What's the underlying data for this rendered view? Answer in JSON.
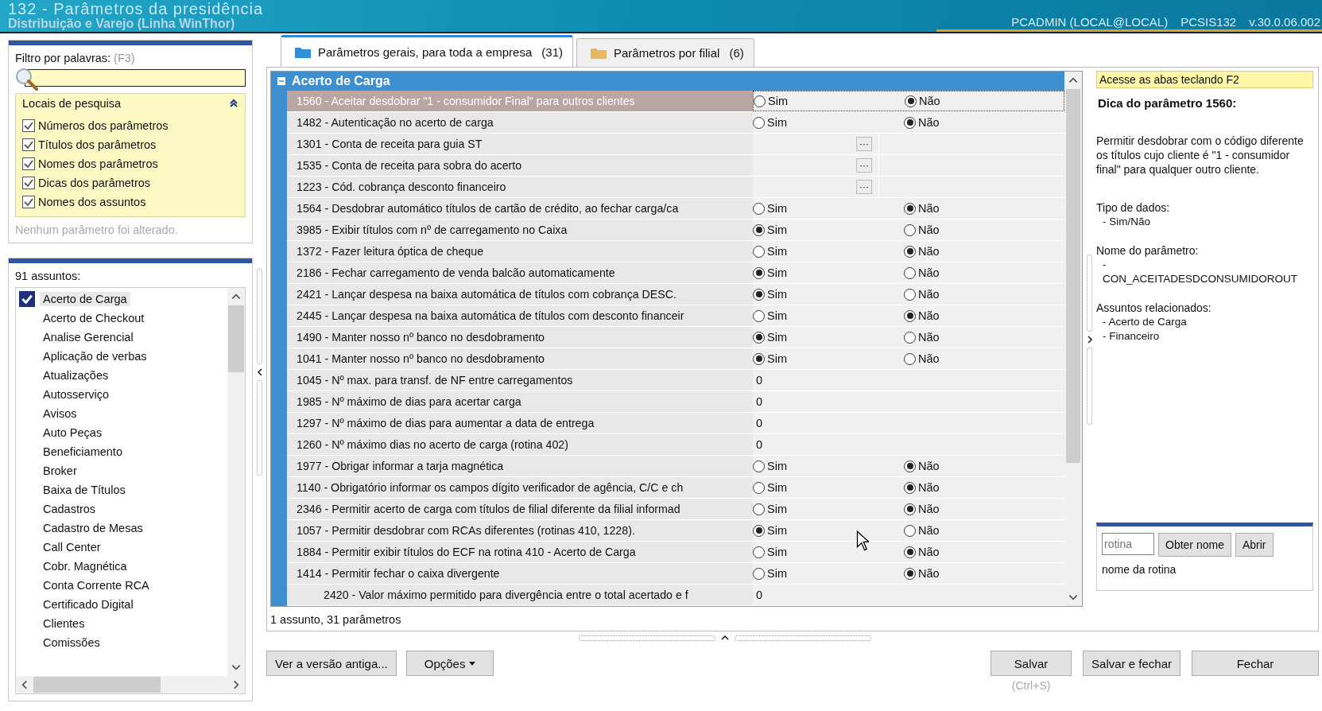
{
  "window": {
    "title": "132 - Parâmetros da presidência",
    "subtitle": "Distribuição e Varejo (Linha WinThor)",
    "user": "PCADMIN (LOCAL@LOCAL)",
    "program": "PCSIS132",
    "version": "v.30.0.06.002"
  },
  "filter": {
    "label": "Filtro por palavras:",
    "shortcut": "(F3)"
  },
  "search_locations": {
    "title": "Locais de pesquisa",
    "expanded": true,
    "options": [
      {
        "label": "Números dos parâmetros",
        "checked": true
      },
      {
        "label": "Títulos dos parâmetros",
        "checked": true
      },
      {
        "label": "Nomes dos parâmetros",
        "checked": true
      },
      {
        "label": "Dicas dos parâmetros",
        "checked": true
      },
      {
        "label": "Nomes dos assuntos",
        "checked": true
      }
    ]
  },
  "change_note": "Nenhum parâmetro foi alterado.",
  "subjects": {
    "count_label": "91 assuntos:",
    "items": [
      {
        "label": "Acerto de Carga",
        "checked": true,
        "selected": true
      },
      {
        "label": "Acerto de Checkout",
        "checked": false,
        "selected": false
      },
      {
        "label": "Analise Gerencial",
        "checked": false,
        "selected": false
      },
      {
        "label": "Aplicação de verbas",
        "checked": false,
        "selected": false
      },
      {
        "label": "Atualizações",
        "checked": false,
        "selected": false
      },
      {
        "label": "Autosserviço",
        "checked": false,
        "selected": false
      },
      {
        "label": "Avisos",
        "checked": false,
        "selected": false
      },
      {
        "label": "Auto Peças",
        "checked": false,
        "selected": false
      },
      {
        "label": "Beneficiamento",
        "checked": false,
        "selected": false
      },
      {
        "label": "Broker",
        "checked": false,
        "selected": false
      },
      {
        "label": "Baixa de Títulos",
        "checked": false,
        "selected": false
      },
      {
        "label": "Cadastros",
        "checked": false,
        "selected": false
      },
      {
        "label": "Cadastro de Mesas",
        "checked": false,
        "selected": false
      },
      {
        "label": "Call Center",
        "checked": false,
        "selected": false
      },
      {
        "label": "Cobr. Magnética",
        "checked": false,
        "selected": false
      },
      {
        "label": "Conta Corrente RCA",
        "checked": false,
        "selected": false
      },
      {
        "label": "Certificado Digital",
        "checked": false,
        "selected": false
      },
      {
        "label": "Clientes",
        "checked": false,
        "selected": false
      },
      {
        "label": "Comissões",
        "checked": false,
        "selected": false
      }
    ]
  },
  "tabs": [
    {
      "label": "Parâmetros gerais, para toda a empresa",
      "count": "(31)",
      "selected": true,
      "color": "#2f8fd8"
    },
    {
      "label": "Parâmetros por filial",
      "count": "(6)",
      "selected": false,
      "color": "#e8b860"
    }
  ],
  "group": {
    "title": "Acerto de Carga",
    "expanded": true
  },
  "parameters": [
    {
      "label": "1560 - Aceitar desdobrar \"1 - consumidor Final\" para outros clientes",
      "kind": "yesno",
      "selected": true,
      "options": [
        {
          "label": "Sim",
          "selected": false
        },
        {
          "label": "Não",
          "selected": true
        }
      ]
    },
    {
      "label": "1482 - Autenticação no acerto de carga",
      "kind": "yesno",
      "selected": false,
      "options": [
        {
          "label": "Sim",
          "selected": false
        },
        {
          "label": "Não",
          "selected": true
        }
      ]
    },
    {
      "label": "1301 - Conta de receita para guia ST",
      "kind": "lookup",
      "selected": false,
      "button": "···"
    },
    {
      "label": "1535 - Conta de receita para sobra do acerto",
      "kind": "lookup",
      "selected": false,
      "button": "···"
    },
    {
      "label": "1223 - Cód. cobrança desconto financeiro",
      "kind": "lookup",
      "selected": false,
      "button": "···"
    },
    {
      "label": "1564 - Desdobrar automático títulos de cartão de crédito, ao fechar carga/ca",
      "kind": "yesno",
      "selected": false,
      "options": [
        {
          "label": "Sim",
          "selected": false
        },
        {
          "label": "Não",
          "selected": true
        }
      ]
    },
    {
      "label": "3985 - Exibir títulos com nº de carregamento no Caixa",
      "kind": "yesno",
      "selected": false,
      "options": [
        {
          "label": "Sim",
          "selected": true
        },
        {
          "label": "Não",
          "selected": false
        }
      ]
    },
    {
      "label": "1372 - Fazer leitura óptica de cheque",
      "kind": "yesno",
      "selected": false,
      "options": [
        {
          "label": "Sim",
          "selected": false
        },
        {
          "label": "Não",
          "selected": true
        }
      ]
    },
    {
      "label": "2186 - Fechar carregamento de venda balcão automaticamente",
      "kind": "yesno",
      "selected": false,
      "options": [
        {
          "label": "Sim",
          "selected": true
        },
        {
          "label": "Não",
          "selected": false
        }
      ]
    },
    {
      "label": "2421 - Lançar despesa na baixa automática de títulos com cobrança DESC.",
      "kind": "yesno",
      "selected": false,
      "options": [
        {
          "label": "Sim",
          "selected": true
        },
        {
          "label": "Não",
          "selected": false
        }
      ]
    },
    {
      "label": "2445 - Lançar despesa na baixa automática de títulos com desconto financeir",
      "kind": "yesno",
      "selected": false,
      "options": [
        {
          "label": "Sim",
          "selected": false
        },
        {
          "label": "Não",
          "selected": true
        }
      ]
    },
    {
      "label": "1490 - Manter nosso nº banco no desdobramento",
      "kind": "yesno",
      "selected": false,
      "options": [
        {
          "label": "Sim",
          "selected": true
        },
        {
          "label": "Não",
          "selected": false
        }
      ]
    },
    {
      "label": "1041 - Manter nosso nº banco no desdobramento",
      "kind": "yesno",
      "selected": false,
      "options": [
        {
          "label": "Sim",
          "selected": true
        },
        {
          "label": "Não",
          "selected": false
        }
      ]
    },
    {
      "label": "1045 - Nº max. para transf. de NF entre carregamentos",
      "kind": "number",
      "selected": false,
      "value": "0"
    },
    {
      "label": "1985 - Nº máximo de dias para acertar carga",
      "kind": "number",
      "selected": false,
      "value": "0"
    },
    {
      "label": "1297 - Nº máximo de dias para aumentar a data de entrega",
      "kind": "number",
      "selected": false,
      "value": "0"
    },
    {
      "label": "1260 - Nº máximo dias no acerto de carga (rotina 402)",
      "kind": "number",
      "selected": false,
      "value": "0"
    },
    {
      "label": "1977 - Obrigar informar a tarja magnética",
      "kind": "yesno",
      "selected": false,
      "options": [
        {
          "label": "Sim",
          "selected": false
        },
        {
          "label": "Não",
          "selected": true
        }
      ]
    },
    {
      "label": "1140 - Obrigatório informar os campos dígito verificador de agência, C/C e ch",
      "kind": "yesno",
      "selected": false,
      "options": [
        {
          "label": "Sim",
          "selected": false
        },
        {
          "label": "Não",
          "selected": true
        }
      ]
    },
    {
      "label": "2346 - Permitir acerto de carga com títulos de filial diferente da filial informad",
      "kind": "yesno",
      "selected": false,
      "options": [
        {
          "label": "Sim",
          "selected": false
        },
        {
          "label": "Não",
          "selected": true
        }
      ]
    },
    {
      "label": "1057 - Permitir desdobrar com RCAs diferentes (rotinas 410, 1228).",
      "kind": "yesno",
      "selected": false,
      "options": [
        {
          "label": "Sim",
          "selected": true
        },
        {
          "label": "Não",
          "selected": false
        }
      ]
    },
    {
      "label": "1884 - Permitir exibir títulos do ECF na rotina 410 - Acerto de Carga",
      "kind": "yesno",
      "selected": false,
      "options": [
        {
          "label": "Sim",
          "selected": false
        },
        {
          "label": "Não",
          "selected": true
        }
      ]
    },
    {
      "label": "1414 - Permitir fechar o caixa divergente",
      "kind": "yesno",
      "selected": false,
      "options": [
        {
          "label": "Sim",
          "selected": false
        },
        {
          "label": "Não",
          "selected": true
        }
      ],
      "children": [
        {
          "label": "2420 - Valor máximo permitido para divergência entre o total acertado e f",
          "kind": "number",
          "selected": false,
          "value": "0"
        }
      ]
    }
  ],
  "status": "1 assunto, 31 parâmetros",
  "hint": {
    "banner": "Acesse as abas teclando F2",
    "title": "Dica do parâmetro 1560:",
    "description": "Permitir desdobrar com o código diferente os títulos cujo cliente é \"1 - consumidor final\" para qualquer outro cliente.",
    "sections": [
      {
        "heading": "Tipo de dados:",
        "lines": [
          "- Sim/Não"
        ]
      },
      {
        "heading": "Nome do parâmetro:",
        "lines": [
          "-",
          "CON_ACEITADESDCONSUMIDOROUT"
        ]
      },
      {
        "heading": "Assuntos relacionados:",
        "lines": [
          "- Acerto de Carga",
          "- Financeiro"
        ]
      }
    ]
  },
  "routine": {
    "placeholder": "rotina",
    "buttons": [
      "Obter nome",
      "Abrir"
    ],
    "caption": "nome da rotina"
  },
  "left_buttons": [
    {
      "label": "Ver a versão antiga...",
      "kind": "plain"
    },
    {
      "label": "Opções",
      "kind": "dropdown"
    }
  ],
  "right_buttons": [
    {
      "label": "Salvar",
      "shortcut": "(Ctrl+S)"
    },
    {
      "label": "Salvar e fechar"
    },
    {
      "label": "Fechar"
    }
  ]
}
